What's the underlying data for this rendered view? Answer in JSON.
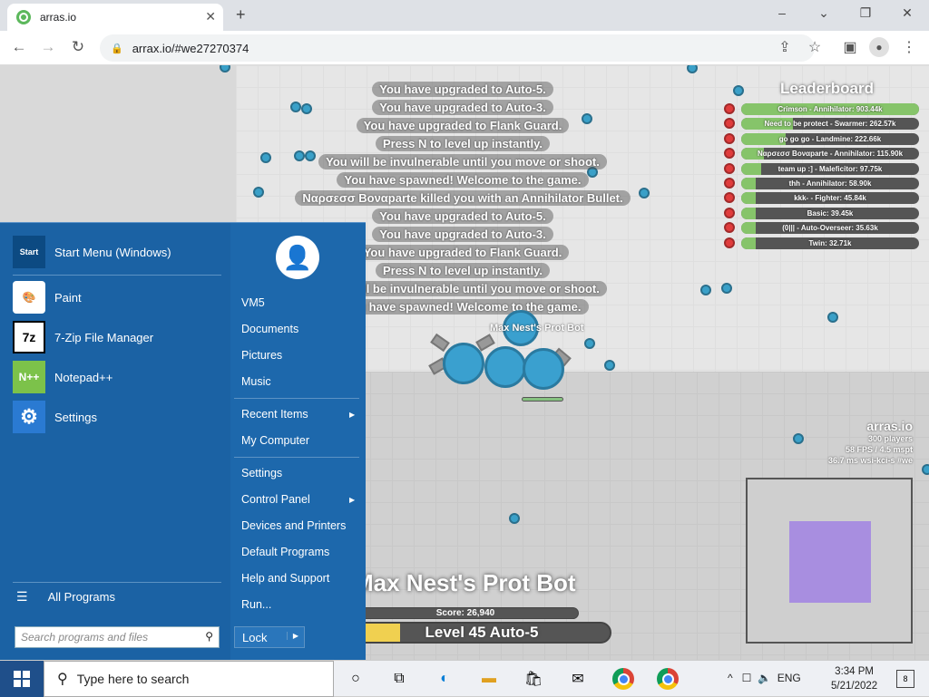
{
  "browser": {
    "tab_title": "arras.io",
    "url": "arrax.io/#we27270374",
    "window_controls": {
      "minimize": "–",
      "maximize": "❐",
      "close": "✕"
    }
  },
  "game": {
    "messages": [
      "You have upgraded to Auto-5.",
      "You have upgraded to Auto-3.",
      "You have upgraded to Flank Guard.",
      "Press N to level up instantly.",
      "You will be invulnerable until you move or shoot.",
      "You have spawned! Welcome to the game.",
      "Ναρσεσσ Βοναparte killed you with an Annihilator Bullet.",
      "You have upgraded to Auto-5.",
      "You have upgraded to Auto-3.",
      "You have upgraded to Flank Guard.",
      "Press N to level up instantly.",
      "You will be invulnerable until you move or shoot.",
      "You have spawned! Welcome to the game."
    ],
    "bot_label": "Max Nest's Prot Bot",
    "leaderboard": {
      "title": "Leaderboard",
      "rows": [
        {
          "text": "Crimson - Annihilator: 903.44k",
          "fill": 1.0
        },
        {
          "text": "Need to be protect - Swarmer: 262.57k",
          "fill": 0.29
        },
        {
          "text": "go go go - Landmine: 222.66k",
          "fill": 0.25
        },
        {
          "text": "Ναρσεσσ Βοναparte - Annihilator: 115.90k",
          "fill": 0.13
        },
        {
          "text": "team up :] - Maleficitor: 97.75k",
          "fill": 0.11
        },
        {
          "text": "thh - Annihilator: 58.90k",
          "fill": 0.07
        },
        {
          "text": "kkk- - Fighter: 45.84k",
          "fill": 0.05
        },
        {
          "text": "Basic: 39.45k",
          "fill": 0.045
        },
        {
          "text": "(0||| - Auto-Overseer: 35.63k",
          "fill": 0.04
        },
        {
          "text": "Twin: 32.71k",
          "fill": 0.036
        }
      ]
    },
    "server_info": {
      "name": "arras.io",
      "players": "300 players",
      "fps": "58 FPS / 4.5 mspt",
      "latency": "36.7 ms  wsi-kci-s #we"
    },
    "hud": {
      "player_name": "Max Nest's Prot Bot",
      "score": "Score: 26,940",
      "level": "Level 45 Auto-5",
      "level_progress": 0.18
    }
  },
  "start_menu": {
    "pinned": [
      {
        "label": "Start Menu (Windows)",
        "icon": "start-menu-icon"
      },
      {
        "label": "Paint",
        "icon": "paint-icon"
      },
      {
        "label": "7-Zip File Manager",
        "icon": "7zip-icon"
      },
      {
        "label": "Notepad++",
        "icon": "notepadpp-icon"
      },
      {
        "label": "Settings",
        "icon": "gear-icon"
      }
    ],
    "all_programs": "All Programs",
    "search_placeholder": "Search programs and files",
    "right_items": [
      "VM5",
      "Documents",
      "Pictures",
      "Music",
      "Recent Items",
      "My Computer",
      "Settings",
      "Control Panel",
      "Devices and Printers",
      "Default Programs",
      "Help and Support",
      "Run..."
    ],
    "lock": "Lock"
  },
  "taskbar": {
    "search_placeholder": "Type here to search",
    "language": "ENG",
    "time": "3:34 PM",
    "date": "5/21/2022",
    "notifications": "8"
  }
}
